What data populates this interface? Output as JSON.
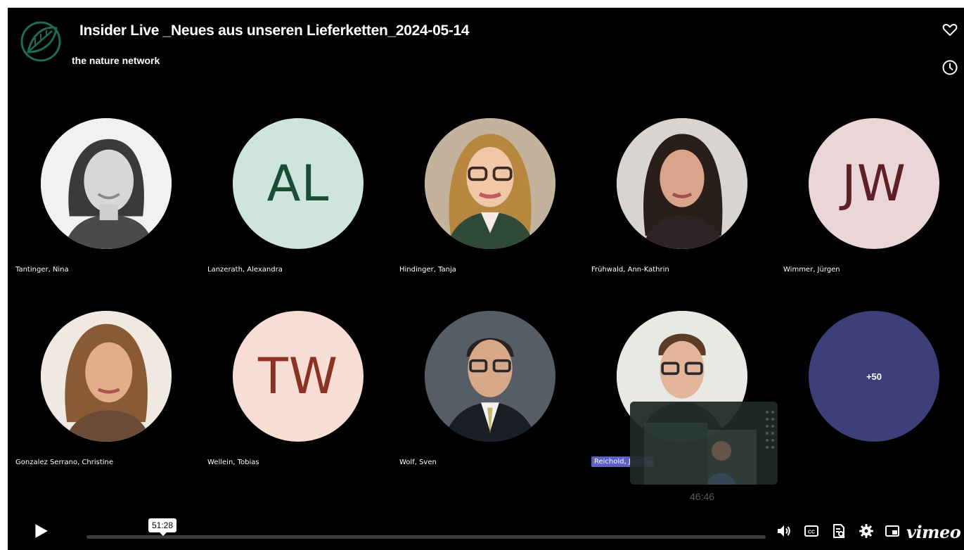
{
  "video": {
    "title": "Insider Live _Neues aus unseren Lieferketten_2024-05-14",
    "channel": "the nature network",
    "accent_color": "#1e6b4f"
  },
  "participants": [
    {
      "name": "Tantinger, Nina",
      "type": "photo"
    },
    {
      "name": "Lanzerath, Alexandra",
      "type": "initials",
      "initials": "AL",
      "bg": "#cde5dd",
      "fg": "#1a4d36"
    },
    {
      "name": "Hindinger, Tanja",
      "type": "photo"
    },
    {
      "name": "Frühwald, Ann-Kathrin",
      "type": "photo"
    },
    {
      "name": "Wimmer, Jürgen",
      "type": "initials",
      "initials": "JW",
      "bg": "#ead5d8",
      "fg": "#5e1f25"
    },
    {
      "name": "Gonzalez Serrano, Christine",
      "type": "photo"
    },
    {
      "name": "Wellein, Tobias",
      "type": "initials",
      "initials": "TW",
      "bg": "#f8ddd4",
      "fg": "#8a3322"
    },
    {
      "name": "Wolf, Sven",
      "type": "photo"
    },
    {
      "name": "Reichold, Joscha",
      "type": "photo",
      "highlighted": true
    },
    {
      "name": "",
      "type": "more",
      "label": "+50",
      "bg": "#3d3f78"
    }
  ],
  "pip": {
    "time": "46:46"
  },
  "player": {
    "hover_time": "51:28",
    "progress": 0.0,
    "icons": [
      "play-icon",
      "volume-icon",
      "captions-icon",
      "transcript-icon",
      "settings-icon",
      "picture-in-picture-icon",
      "vimeo-logo"
    ],
    "brand": "vimeo"
  },
  "side_actions": [
    "heart-icon",
    "clock-icon"
  ]
}
